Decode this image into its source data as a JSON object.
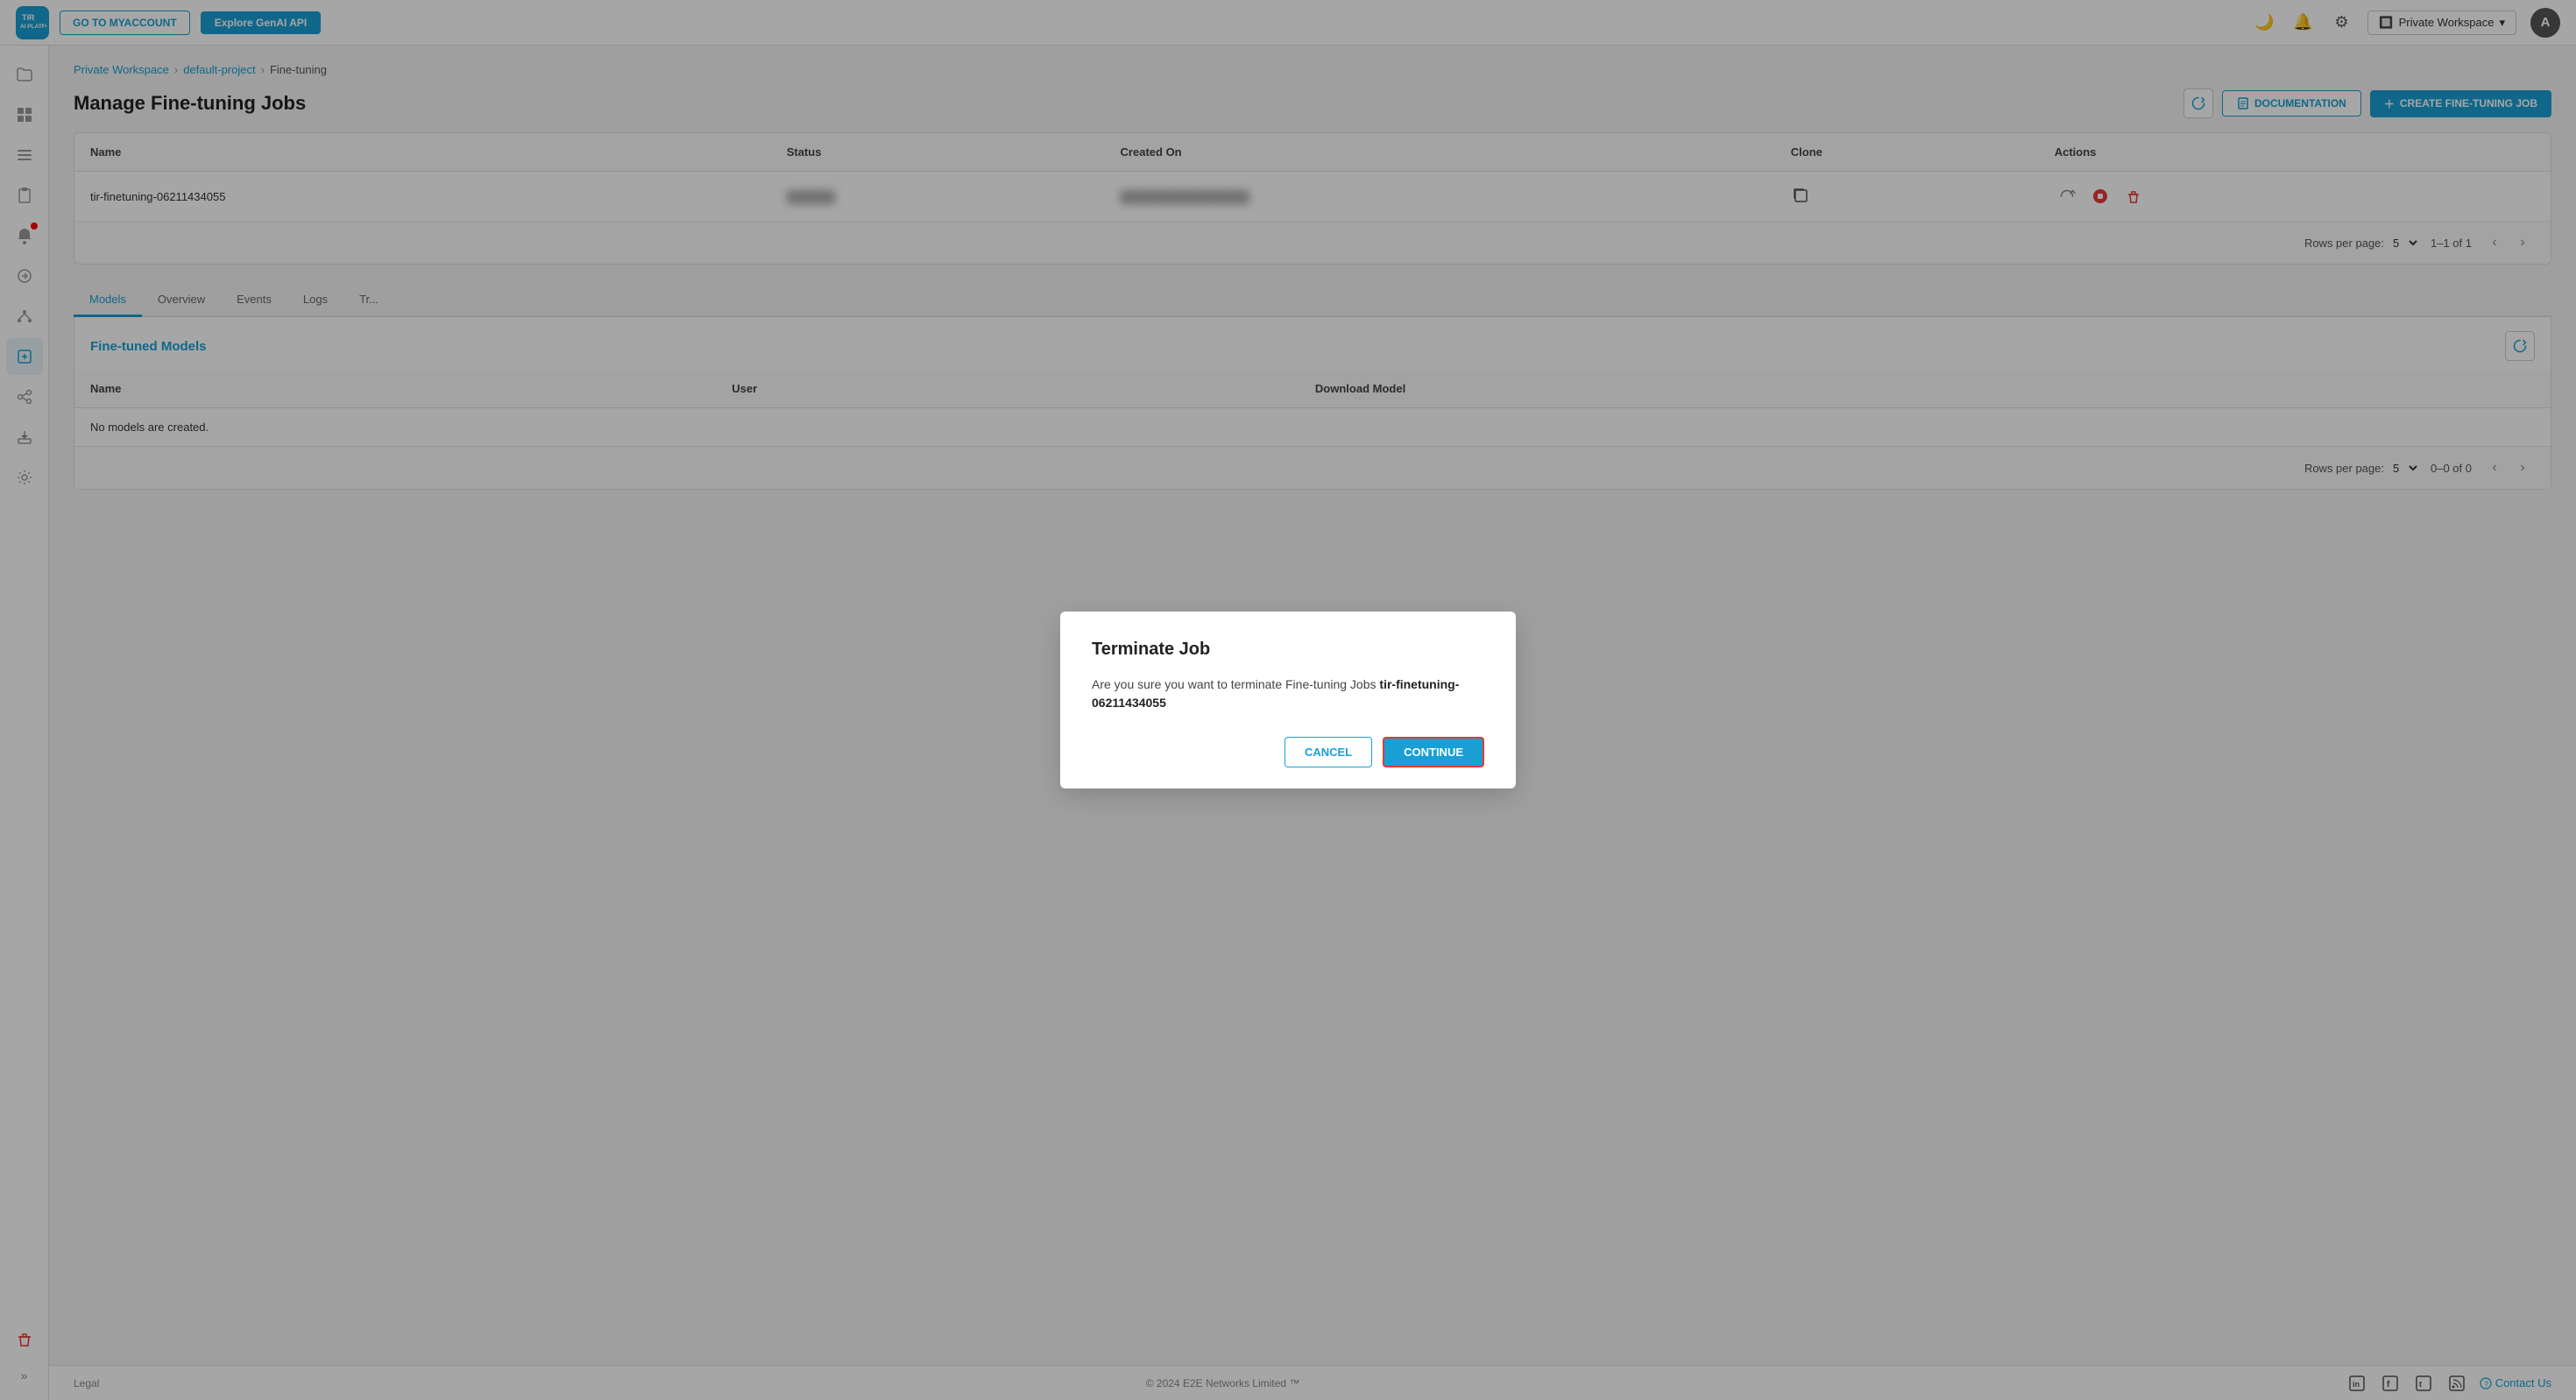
{
  "topnav": {
    "logo_text": "TIR\nAI PLATFORM",
    "btn_myaccount": "GO TO MYACCOUNT",
    "btn_genai": "Explore GenAI API",
    "workspace_label": "Private Workspace",
    "avatar_letter": "A"
  },
  "breadcrumb": {
    "items": [
      "Private Workspace",
      "default-project",
      "Fine-tuning"
    ]
  },
  "page": {
    "title": "Manage Fine-tuning Jobs",
    "btn_refresh_label": "⟳",
    "btn_docs_label": "DOCUMENTATION",
    "btn_create_label": "CREATE FINE-TUNING JOB"
  },
  "table": {
    "columns": [
      "Name",
      "Status",
      "Created On",
      "Clone",
      "Actions"
    ],
    "rows": [
      {
        "name": "tir-finetuning-06211434055",
        "status": "██████",
        "created_on": "████████████████",
        "clone": "📄",
        "actions": [
          "restart",
          "stop",
          "delete"
        ]
      }
    ],
    "rows_per_page_label": "Rows per page:",
    "rows_per_page_value": "5",
    "pagination_info": "1–1 of 1"
  },
  "tabs": {
    "items": [
      "Models",
      "Overview",
      "Events",
      "Logs",
      "Tr..."
    ],
    "active": "Models"
  },
  "models_section": {
    "title": "Fine-tuned Models",
    "columns": [
      "Name",
      "User",
      "Download Model"
    ],
    "empty_message": "No models are created.",
    "rows_per_page_label": "Rows per page:",
    "rows_per_page_value": "5",
    "pagination_info": "0–0 of 0"
  },
  "dialog": {
    "title": "Terminate Job",
    "body_prefix": "Are you sure you want to terminate Fine-tuning Jobs ",
    "job_name": "tir-finetuning-06211434055",
    "btn_cancel": "CANCEL",
    "btn_continue": "CONTINUE"
  },
  "footer": {
    "legal": "Legal",
    "copyright": "© 2024 E2E Networks Limited ™",
    "contact_us": "Contact Us",
    "social": [
      "in",
      "f",
      "t",
      "rss"
    ]
  },
  "sidebar": {
    "items": [
      {
        "icon": "⊞",
        "name": "dashboard-icon"
      },
      {
        "icon": "☰",
        "name": "list-icon"
      },
      {
        "icon": "📋",
        "name": "clipboard-icon"
      },
      {
        "icon": "🔔",
        "name": "notification-icon",
        "badge": true
      },
      {
        "icon": "↑↓",
        "name": "transfer-icon"
      },
      {
        "icon": "⬡",
        "name": "nodes-icon"
      },
      {
        "icon": "📦",
        "name": "packages-icon",
        "active": true
      },
      {
        "icon": "🔗",
        "name": "integrations-icon"
      },
      {
        "icon": "📥",
        "name": "import-icon"
      },
      {
        "icon": "⚙",
        "name": "settings-icon"
      },
      {
        "icon": "🗑",
        "name": "trash-icon",
        "red": true
      }
    ]
  }
}
